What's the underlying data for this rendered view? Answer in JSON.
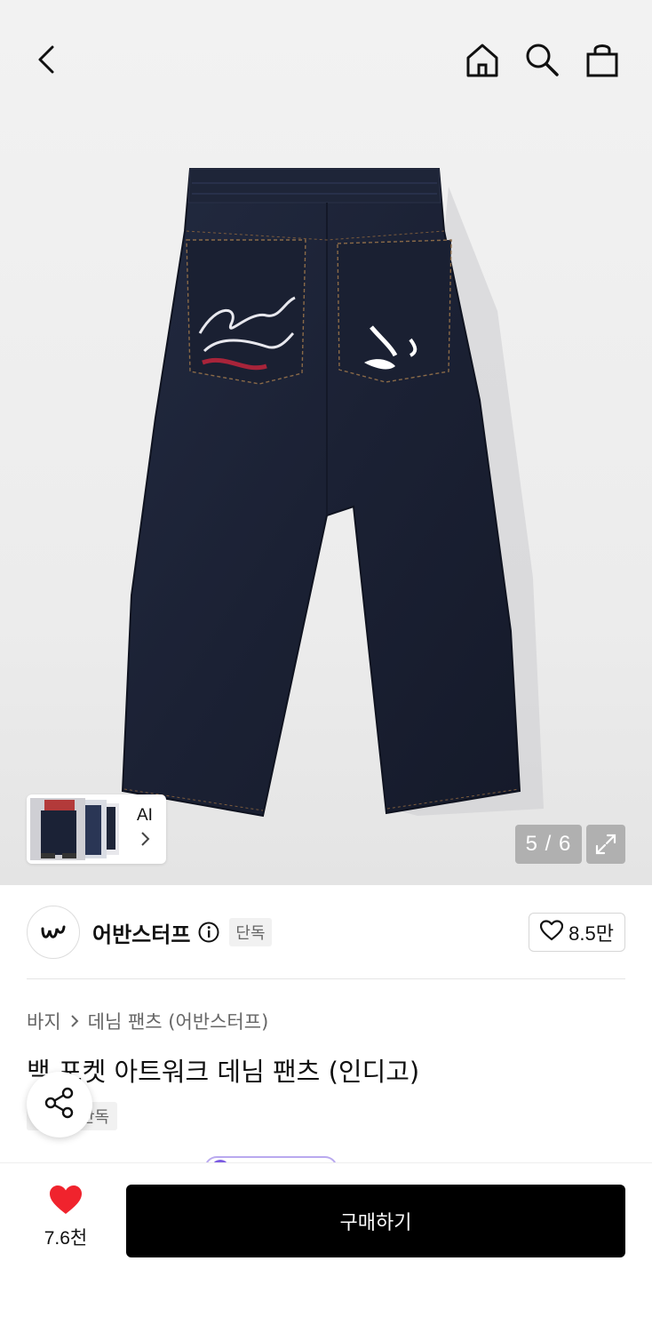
{
  "gallery": {
    "thumb_ai_label": "AI",
    "counter": "5 / 6"
  },
  "brand": {
    "name": "어반스터프",
    "badge": "단독",
    "likes": "8.5만"
  },
  "breadcrumb": {
    "category": "바지",
    "subcategory": "데님 팬츠 (어반스터프)"
  },
  "product": {
    "title": "백 포켓 아트워크 데님 팬츠 (인디고)",
    "badge": "단독"
  },
  "bottom": {
    "likes": "7.6천",
    "buy_label": "구매하기"
  },
  "colors": {
    "denim": "#1c2236",
    "heart": "#f0232d",
    "buy_bg": "#000000"
  }
}
